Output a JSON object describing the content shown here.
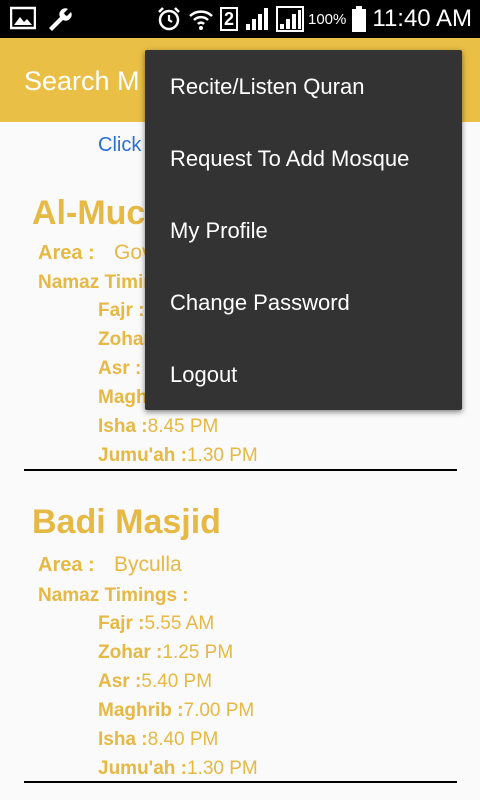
{
  "status_bar": {
    "icons": [
      "image-icon",
      "wrench-icon",
      "alarm-icon",
      "wifi-icon",
      "sim-2-icon",
      "signal-icon",
      "signal-icon",
      "battery-icon"
    ],
    "sim_badge": "2",
    "battery_percent": "100%",
    "time": "11:40 AM"
  },
  "app_bar": {
    "title": "Search M"
  },
  "content": {
    "click_text": "Click",
    "mosques": [
      {
        "name": "Al-Muc",
        "area_label": "Area :",
        "area_value": "Gov",
        "timings_label": "Namaz Timin",
        "timings": [
          {
            "key": "Fajr :",
            "value": ""
          },
          {
            "key": "Zohar",
            "value": ""
          },
          {
            "key": "Asr :",
            "value": ""
          },
          {
            "key": "Magh",
            "value": ""
          },
          {
            "key": "Isha :",
            "value": "8.45 PM"
          },
          {
            "key": "Jumu'ah :",
            "value": "1.30 PM"
          }
        ]
      },
      {
        "name": "Badi Masjid",
        "area_label": "Area :",
        "area_value": "Byculla",
        "timings_label": "Namaz Timings :",
        "timings": [
          {
            "key": "Fajr :",
            "value": "5.55 AM"
          },
          {
            "key": "Zohar :",
            "value": "1.25 PM"
          },
          {
            "key": "Asr :",
            "value": "5.40 PM"
          },
          {
            "key": "Maghrib :",
            "value": "7.00 PM"
          },
          {
            "key": "Isha :",
            "value": "8.40 PM"
          },
          {
            "key": "Jumu'ah :",
            "value": "1.30 PM"
          }
        ]
      }
    ]
  },
  "menu": {
    "items": [
      {
        "label": "Recite/Listen Quran"
      },
      {
        "label": "Request To Add Mosque"
      },
      {
        "label": "My Profile"
      },
      {
        "label": "Change Password"
      },
      {
        "label": "Logout"
      }
    ]
  },
  "colors": {
    "accent": "#e9bf45",
    "text_gold": "#e6b844",
    "menu_bg": "#333333",
    "link": "#2a6fd6"
  }
}
